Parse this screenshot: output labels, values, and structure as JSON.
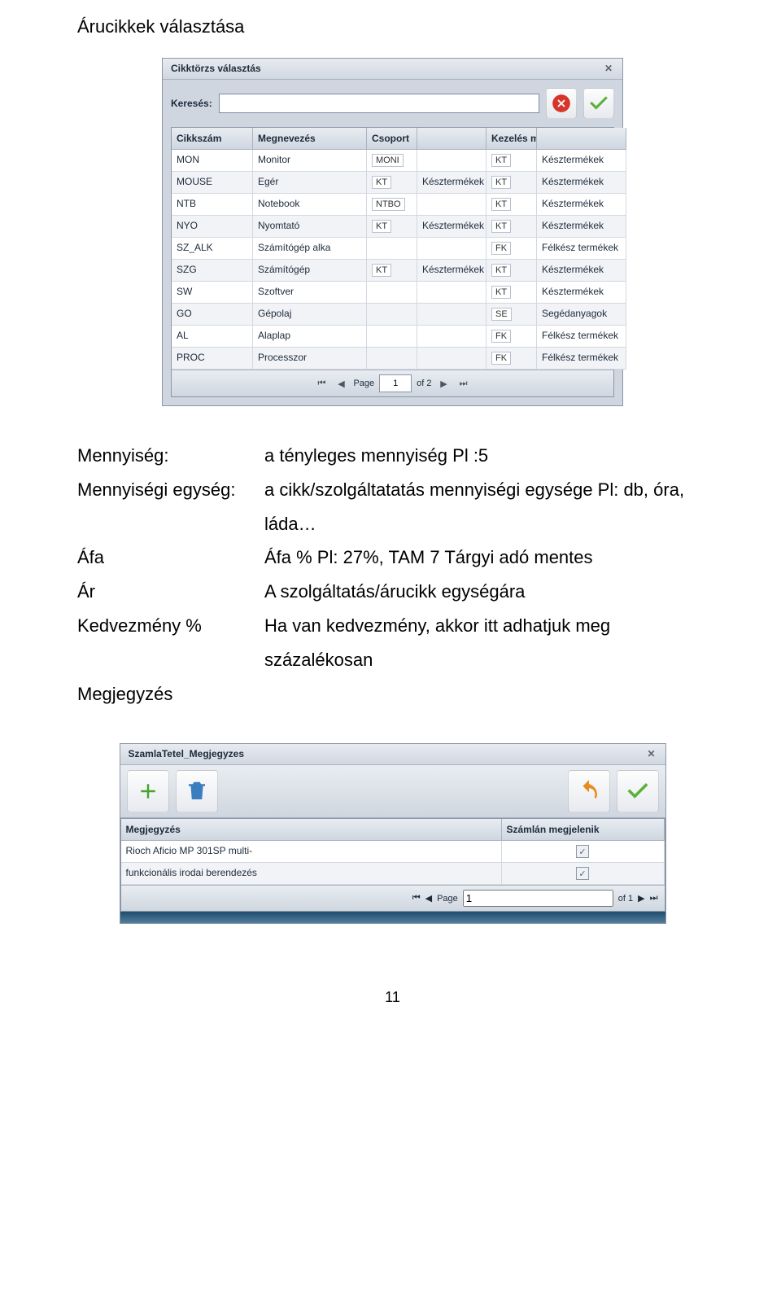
{
  "heading": "Árucikkek választása",
  "dialog1": {
    "title": "Cikktörzs választás",
    "search_label": "Keresés:",
    "search_value": "",
    "columns": [
      "Cikkszám",
      "Megnevezés",
      "Csoport",
      "Kezelés mód"
    ],
    "rows": [
      {
        "code": "MON",
        "name": "Monitor",
        "grp_code": "MONI",
        "grp_name": "",
        "mode_code": "KT",
        "mode_name": "Késztermékek"
      },
      {
        "code": "MOUSE",
        "name": "Egér",
        "grp_code": "KT",
        "grp_name": "Késztermékek",
        "mode_code": "KT",
        "mode_name": "Késztermékek"
      },
      {
        "code": "NTB",
        "name": "Notebook",
        "grp_code": "NTBO",
        "grp_name": "",
        "mode_code": "KT",
        "mode_name": "Késztermékek"
      },
      {
        "code": "NYO",
        "name": "Nyomtató",
        "grp_code": "KT",
        "grp_name": "Késztermékek",
        "mode_code": "KT",
        "mode_name": "Késztermékek"
      },
      {
        "code": "SZ_ALK",
        "name": "Számítógép alka",
        "grp_code": "",
        "grp_name": "",
        "mode_code": "FK",
        "mode_name": "Félkész termékek"
      },
      {
        "code": "SZG",
        "name": "Számítógép",
        "grp_code": "KT",
        "grp_name": "Késztermékek",
        "mode_code": "KT",
        "mode_name": "Késztermékek"
      },
      {
        "code": "SW",
        "name": "Szoftver",
        "grp_code": "",
        "grp_name": "",
        "mode_code": "KT",
        "mode_name": "Késztermékek"
      },
      {
        "code": "GO",
        "name": "Gépolaj",
        "grp_code": "",
        "grp_name": "",
        "mode_code": "SE",
        "mode_name": "Segédanyagok"
      },
      {
        "code": "AL",
        "name": "Alaplap",
        "grp_code": "",
        "grp_name": "",
        "mode_code": "FK",
        "mode_name": "Félkész termékek"
      },
      {
        "code": "PROC",
        "name": "Processzor",
        "grp_code": "",
        "grp_name": "",
        "mode_code": "FK",
        "mode_name": "Félkész termékek"
      }
    ],
    "pager": {
      "page_label": "Page",
      "page": "1",
      "of_label": "of 2"
    }
  },
  "definitions": [
    {
      "k": "Mennyiség:",
      "v": "a tényleges mennyiség  Pl :5"
    },
    {
      "k": "Mennyiségi egység:",
      "v": "a cikk/szolgáltatatás mennyiségi egysége  Pl:  db, óra, láda…"
    },
    {
      "k": "Áfa",
      "v": "Áfa % Pl: 27%, TAM 7 Tárgyi adó mentes"
    },
    {
      "k": "Ár",
      "v": "A szolgáltatás/árucikk  egységára"
    },
    {
      "k": "Kedvezmény %",
      "v": "Ha van kedvezmény, akkor itt adhatjuk meg százalékosan"
    },
    {
      "k": "Megjegyzés",
      "v": ""
    }
  ],
  "dialog2": {
    "title": "SzamlaTetel_Megjegyzes",
    "columns": [
      "Megjegyzés",
      "Számlán megjelenik"
    ],
    "rows": [
      {
        "text": "Rioch Aficio MP 301SP multi-",
        "checked": true
      },
      {
        "text": "funkcionális irodai berendezés",
        "checked": true
      }
    ],
    "pager": {
      "page_label": "Page",
      "page": "1",
      "of_label": "of 1"
    }
  },
  "page_number": "11"
}
